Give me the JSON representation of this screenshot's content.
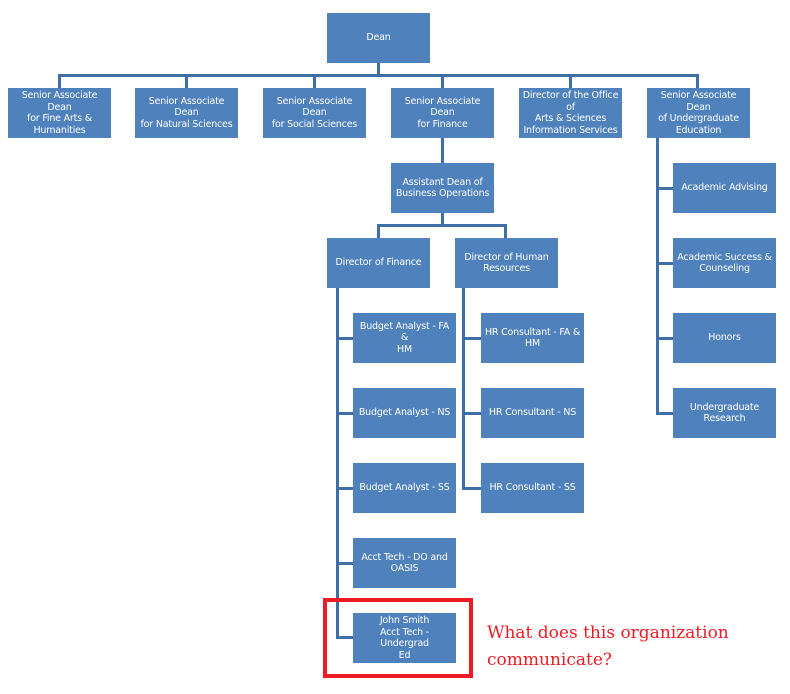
{
  "colors": {
    "box": "#4F81BD",
    "connector": "#3F6EA6",
    "highlight": "#ED1C24",
    "question": "#ED1C24"
  },
  "dean": "Dean",
  "senior": [
    "Senior Associate Dean\nfor Fine Arts &\nHumanities",
    "Senior Associate Dean\nfor Natural Sciences",
    "Senior Associate Dean\nfor Social Sciences",
    "Senior Associate Dean\nfor Finance",
    "Director of the Office of\nArts & Sciences\nInformation Services",
    "Senior Associate Dean\nof Undergraduate\nEducation"
  ],
  "assistant_dean": "Assistant Dean of\nBusiness Operations",
  "director_finance": "Director of Finance",
  "director_hr": "Director of Human\nResources",
  "finance_staff": [
    "Budget Analyst - FA &\nHM",
    "Budget Analyst - NS",
    "Budget Analyst - SS",
    "Acct Tech - DO and\nOASIS",
    "John Smith\nAcct Tech - Undergrad\nEd"
  ],
  "hr_staff": [
    "HR Consultant - FA &\nHM",
    "HR Consultant - NS",
    "HR Consultant - SS"
  ],
  "undergrad_units": [
    "Academic Advising",
    "Academic Success &\nCounseling",
    "Honors",
    "Undergraduate\nResearch"
  ],
  "question": "What does this organization\ncommunicate?"
}
